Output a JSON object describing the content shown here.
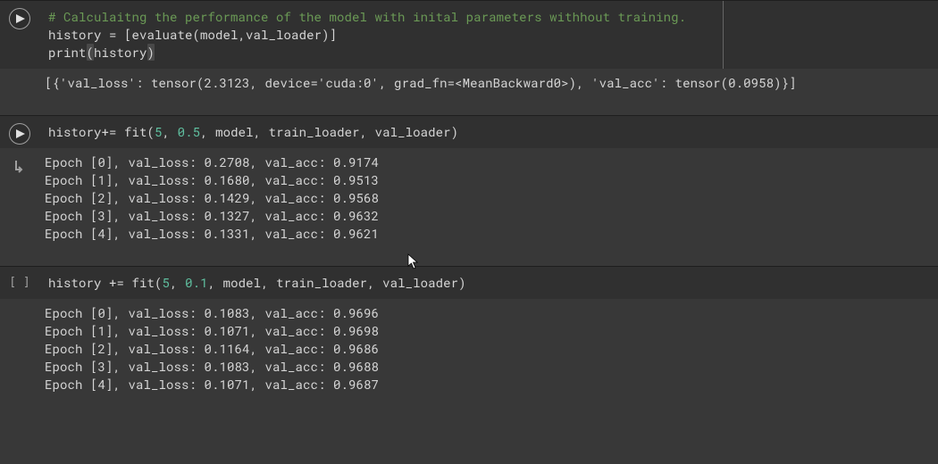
{
  "cells": [
    {
      "type": "code",
      "gutter": "play",
      "code": {
        "line1_comment": "# Calculaitng the performance of the model with inital parameters withhout training.",
        "line2_a": "history ",
        "line2_b": "=",
        "line2_c": " [evaluate(model,val_loader)]",
        "line3_a": "print",
        "line3_b": "(",
        "line3_c": "history",
        "line3_d": ")"
      }
    },
    {
      "type": "output",
      "gutter": "none",
      "text": "[{'val_loss': tensor(2.3123, device='cuda:0', grad_fn=<MeanBackward0>), 'val_acc': tensor(0.0958)}]"
    },
    {
      "type": "code",
      "gutter": "play",
      "code": {
        "line1_a": "history",
        "line1_b": "+=",
        "line1_c": " fit(",
        "line1_d": "5",
        "line1_e": ", ",
        "line1_f": "0.5",
        "line1_g": ", model, train_loader, val_loader)"
      }
    },
    {
      "type": "output",
      "gutter": "outarrow",
      "text": "Epoch [0], val_loss: 0.2708, val_acc: 0.9174\nEpoch [1], val_loss: 0.1680, val_acc: 0.9513\nEpoch [2], val_loss: 0.1429, val_acc: 0.9568\nEpoch [3], val_loss: 0.1327, val_acc: 0.9632\nEpoch [4], val_loss: 0.1331, val_acc: 0.9621"
    },
    {
      "type": "code",
      "gutter": "brackets",
      "code": {
        "line1_a": "history ",
        "line1_b": "+=",
        "line1_c": " fit(",
        "line1_d": "5",
        "line1_e": ", ",
        "line1_f": "0.1",
        "line1_g": ", model, train_loader, val_loader)"
      }
    },
    {
      "type": "output",
      "gutter": "none",
      "text": "Epoch [0], val_loss: 0.1083, val_acc: 0.9696\nEpoch [1], val_loss: 0.1071, val_acc: 0.9698\nEpoch [2], val_loss: 0.1164, val_acc: 0.9686\nEpoch [3], val_loss: 0.1083, val_acc: 0.9688\nEpoch [4], val_loss: 0.1071, val_acc: 0.9687"
    }
  ]
}
